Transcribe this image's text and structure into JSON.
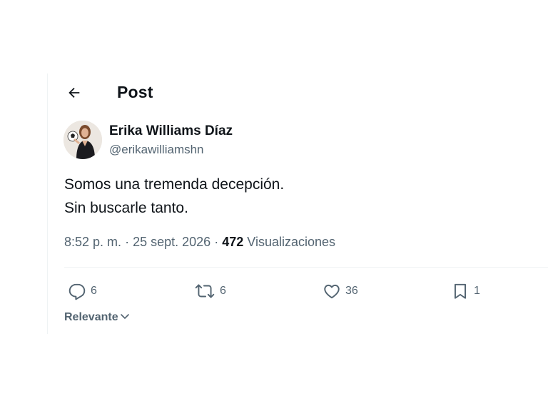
{
  "header": {
    "title": "Post",
    "back_icon": "arrow-left-icon"
  },
  "post": {
    "author_name": "Erika Williams Díaz",
    "author_handle": "@erikawilliamshn",
    "text_lines": [
      "Somos una tremenda decepción.",
      "Sin buscarle tanto."
    ],
    "time": "8:52 p. m.",
    "separator": "·",
    "date": "25 sept. 2026",
    "views_count": "472",
    "views_label": "Visualizaciones"
  },
  "actions": {
    "reply": {
      "icon": "reply-icon",
      "count": "6"
    },
    "repost": {
      "icon": "repost-icon",
      "count": "6"
    },
    "like": {
      "icon": "heart-icon",
      "count": "36"
    },
    "bookmark": {
      "icon": "bookmark-icon",
      "count": "1"
    }
  },
  "sort": {
    "label": "Relevante",
    "icon": "chevron-down-icon"
  },
  "colors": {
    "text_primary": "#0f1419",
    "text_secondary": "#536471",
    "divider": "#eff3f4"
  }
}
